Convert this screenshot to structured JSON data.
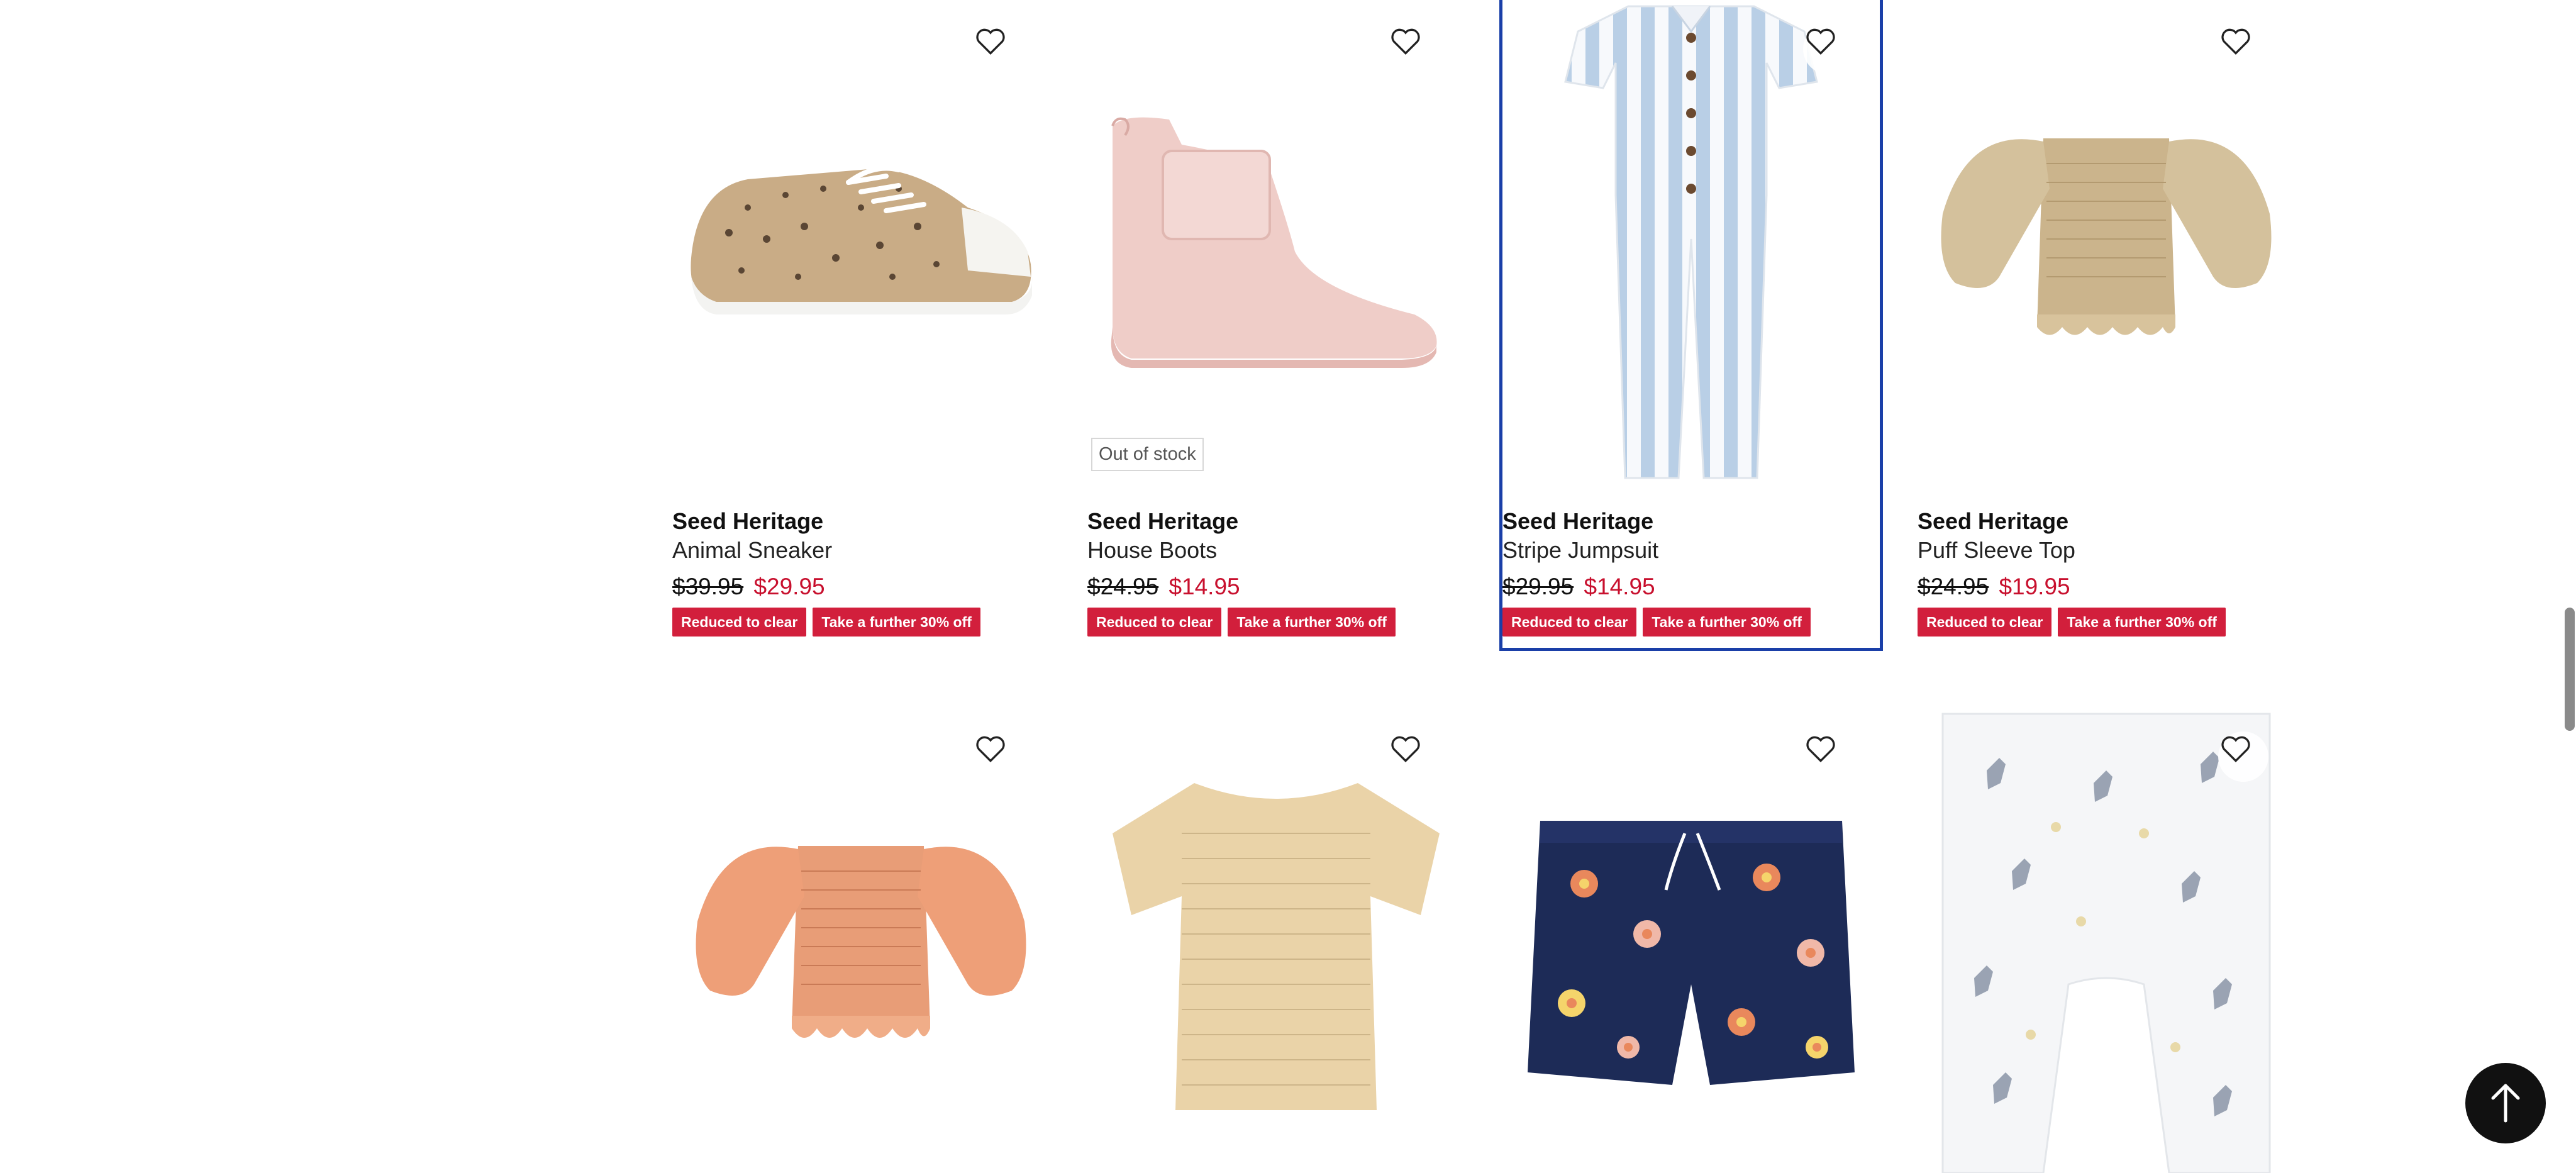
{
  "products": [
    {
      "brand": "Seed Heritage",
      "name": "Animal Sneaker",
      "was_price": "$39.95",
      "now_price": "$29.95",
      "badges": [
        "Reduced to clear",
        "Take a further 30% off"
      ],
      "image_icon": "sneaker",
      "stock_label": ""
    },
    {
      "brand": "Seed Heritage",
      "name": "House Boots",
      "was_price": "$24.95",
      "now_price": "$14.95",
      "badges": [
        "Reduced to clear",
        "Take a further 30% off"
      ],
      "image_icon": "boot",
      "stock_label": "Out of stock"
    },
    {
      "brand": "Seed Heritage",
      "name": "Stripe Jumpsuit",
      "was_price": "$29.95",
      "now_price": "$14.95",
      "badges": [
        "Reduced to clear",
        "Take a further 30% off"
      ],
      "image_icon": "jumpsuit",
      "stock_label": ""
    },
    {
      "brand": "Seed Heritage",
      "name": "Puff Sleeve Top",
      "was_price": "$24.95",
      "now_price": "$19.95",
      "badges": [
        "Reduced to clear",
        "Take a further 30% off"
      ],
      "image_icon": "puff-top-tan",
      "stock_label": ""
    },
    {
      "image_icon": "puff-top-orange"
    },
    {
      "image_icon": "smocked-tee"
    },
    {
      "image_icon": "floral-shorts"
    },
    {
      "image_icon": "reindeer-pants"
    }
  ],
  "colors": {
    "sale_red": "#c8102e",
    "badge_red": "#d21f3c",
    "focus_outline": "#1a3fa8"
  },
  "icons": {
    "favourite": "heart-outline-icon",
    "back_to_top": "arrow-up-icon"
  }
}
